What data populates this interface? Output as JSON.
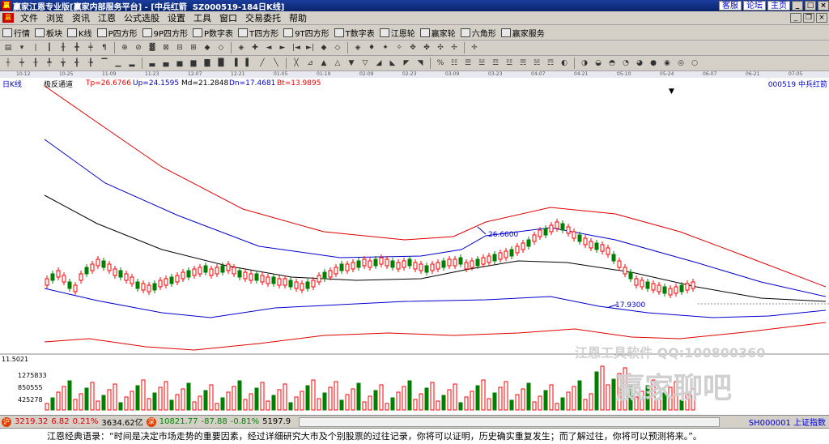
{
  "titlebar": {
    "title": "赢家江恩专业版[赢家内部服务平台] - [中兵红箭  SZ000519-184日K线]",
    "links": [
      "客服",
      "论坛",
      "主页"
    ]
  },
  "menu": [
    "文件",
    "浏览",
    "资讯",
    "江恩",
    "公式选股",
    "设置",
    "工具",
    "窗口",
    "交易委托",
    "帮助"
  ],
  "toolbar1": [
    {
      "label": "行情",
      "icon": "grid-icon"
    },
    {
      "label": "板块",
      "icon": "blocks-icon"
    },
    {
      "label": "K线",
      "icon": "candle-icon"
    },
    {
      "label": "P四方形",
      "icon": "p-square-icon"
    },
    {
      "label": "9P四方形",
      "icon": "9p-square-icon"
    },
    {
      "label": "P数字表",
      "icon": "p-table-icon"
    },
    {
      "label": "T四方形",
      "icon": "t-square-icon"
    },
    {
      "label": "9T四方形",
      "icon": "9t-square-icon"
    },
    {
      "label": "T数字表",
      "icon": "t-table-icon"
    },
    {
      "label": "江恩轮",
      "icon": "gann-wheel-icon"
    },
    {
      "label": "赢家轮",
      "icon": "winner-wheel-icon"
    },
    {
      "label": "六角形",
      "icon": "hexagon-icon"
    },
    {
      "label": "赢家服务",
      "icon": "service-icon"
    }
  ],
  "dates": [
    "10-12",
    "10-25",
    "11-09",
    "11-23",
    "12-07",
    "12-21",
    "01-05",
    "01-19",
    "02-09",
    "02-23",
    "03-09",
    "03-23",
    "04-07",
    "04-21",
    "05-10",
    "05-24",
    "06-07",
    "06-21",
    "07-05"
  ],
  "infobar": {
    "period": "日K线",
    "indicator": "极反通道",
    "tp": "Tp=26.6766",
    "up": "Up=24.1595",
    "md": "Md=21.2848",
    "dn": "Dn=17.4681",
    "bt": "Bt=13.9895",
    "stock": "000519  中兵红箭"
  },
  "annotations": {
    "high": "26.6600",
    "low": "17.9300"
  },
  "volume_axis": [
    "11.5021",
    "1275833",
    "850555",
    "425278"
  ],
  "watermark": {
    "line1": "江恩工具软件  QQ:100800360",
    "line2": "赢家聊吧"
  },
  "statusbar": {
    "sh_value": "3219.32",
    "sh_change": "6.82",
    "sh_pct": "0.21%",
    "sh_amount": "3634.62亿",
    "sz_value": "10821.77",
    "sz_change": "-87.88",
    "sz_pct": "-0.81%",
    "sz_amount": "5197.9",
    "index_label": "SH000001 上证指数"
  },
  "quote": "江恩经典语录：“时间是决定市场走势的重要因素，经过详细研究大市及个别股票的过往记录，你将可以证明，历史确实重复发生；而了解过往，你将可以预测将来。”。",
  "colors": {
    "up": "#ff0000",
    "down": "#008000",
    "outer_band": "#e00000",
    "inner_band": "#0000cc",
    "mid": "#000000"
  }
}
